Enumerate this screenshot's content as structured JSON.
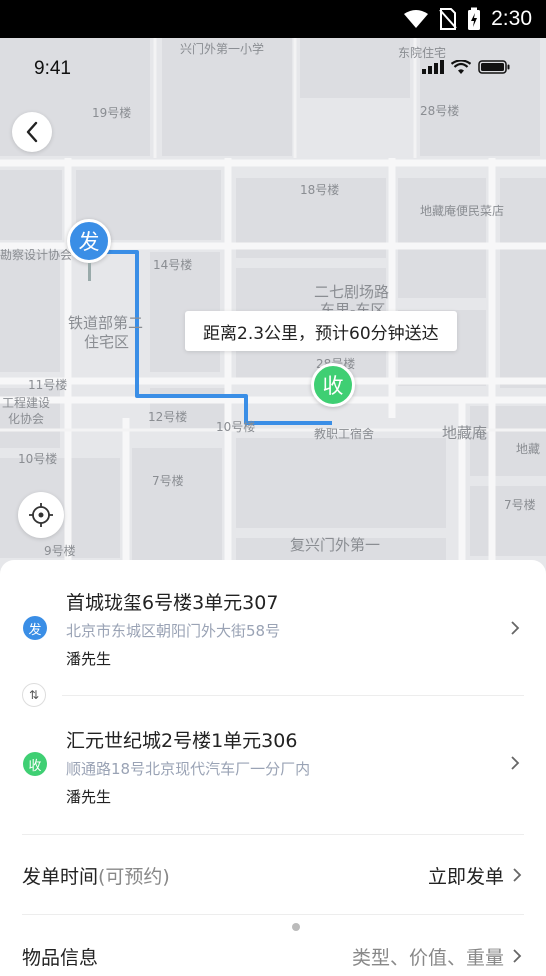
{
  "android_status": {
    "time": "2:30"
  },
  "ios_status": {
    "time": "9:41"
  },
  "map_labels": {
    "l1": "兴门外第一小学",
    "l2": "东院住宅",
    "l3": "19号楼",
    "l4": "28号楼",
    "l5": "18号楼",
    "l6": "地藏庵便民菜店",
    "l7": "勘察设计协会",
    "l8": "14号楼",
    "l9": "二七剧场路",
    "l10": "东里-东区",
    "l11": "铁道部第二",
    "l12": "住宅区",
    "l13": "11号楼",
    "l14": "工程建设",
    "l15": "化协会",
    "l16": "12号楼",
    "l17": "10号楼",
    "l18": "教职工宿舍",
    "l19": "地藏庵",
    "l20": "地藏",
    "l21": "10号楼",
    "l22": "7号楼",
    "l23": "7号楼",
    "l24": "复兴门外第一",
    "l25": "9号楼",
    "l26": "28号楼"
  },
  "pins": {
    "send": "发",
    "receive": "收"
  },
  "route_tip": "距离2.3公里，预计60分钟送达",
  "sender": {
    "badge": "发",
    "title": "首城珑玺6号楼3单元307",
    "address": "北京市东城区朝阳门外大街58号",
    "name": "潘先生"
  },
  "swap_icon_text": "⇅",
  "receiver": {
    "badge": "收",
    "title": "汇元世纪城2号楼1单元306",
    "address": "顺通路18号北京现代汽车厂一分厂内",
    "name": "潘先生"
  },
  "order_time": {
    "label": "发单时间",
    "hint": "(可预约)",
    "value": "立即发单"
  },
  "item_info": {
    "label": "物品信息",
    "value": "类型、价值、重量"
  },
  "colors": {
    "send": "#3a8ee6",
    "receive": "#3fcf73",
    "route": "#3a8ee6"
  }
}
